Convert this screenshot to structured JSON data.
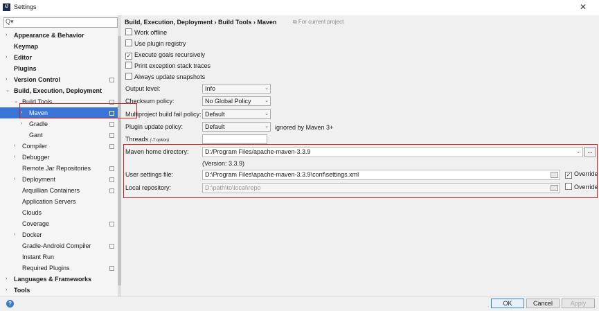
{
  "window": {
    "title": "Settings",
    "app_icon": "IJ"
  },
  "sidebar": {
    "search_placeholder": "Q▾",
    "items": [
      {
        "label": "Appearance & Behavior",
        "level": 0,
        "arrow": "›",
        "bold": true
      },
      {
        "label": "Keymap",
        "level": 0,
        "arrow": "",
        "bold": true
      },
      {
        "label": "Editor",
        "level": 0,
        "arrow": "›",
        "bold": true
      },
      {
        "label": "Plugins",
        "level": 0,
        "arrow": "",
        "bold": true
      },
      {
        "label": "Version Control",
        "level": 0,
        "arrow": "›",
        "bold": true,
        "project": true
      },
      {
        "label": "Build, Execution, Deployment",
        "level": 0,
        "arrow": "⌄",
        "bold": true
      },
      {
        "label": "Build Tools",
        "level": 1,
        "arrow": "⌄",
        "bold": false,
        "project": true
      },
      {
        "label": "Maven",
        "level": 2,
        "arrow": "›",
        "bold": false,
        "project": true,
        "selected": true
      },
      {
        "label": "Gradle",
        "level": 2,
        "arrow": "›",
        "bold": false,
        "project": true
      },
      {
        "label": "Gant",
        "level": 2,
        "arrow": "",
        "bold": false,
        "project": true
      },
      {
        "label": "Compiler",
        "level": 1,
        "arrow": "›",
        "bold": false,
        "project": true
      },
      {
        "label": "Debugger",
        "level": 1,
        "arrow": "›",
        "bold": false
      },
      {
        "label": "Remote Jar Repositories",
        "level": 1,
        "arrow": "",
        "bold": false,
        "project": true
      },
      {
        "label": "Deployment",
        "level": 1,
        "arrow": "›",
        "bold": false,
        "project": true
      },
      {
        "label": "Arquillian Containers",
        "level": 1,
        "arrow": "",
        "bold": false,
        "project": true
      },
      {
        "label": "Application Servers",
        "level": 1,
        "arrow": "",
        "bold": false
      },
      {
        "label": "Clouds",
        "level": 1,
        "arrow": "",
        "bold": false
      },
      {
        "label": "Coverage",
        "level": 1,
        "arrow": "",
        "bold": false,
        "project": true
      },
      {
        "label": "Docker",
        "level": 1,
        "arrow": "›",
        "bold": false
      },
      {
        "label": "Gradle-Android Compiler",
        "level": 1,
        "arrow": "",
        "bold": false,
        "project": true
      },
      {
        "label": "Instant Run",
        "level": 1,
        "arrow": "",
        "bold": false
      },
      {
        "label": "Required Plugins",
        "level": 1,
        "arrow": "",
        "bold": false,
        "project": true
      },
      {
        "label": "Languages & Frameworks",
        "level": 0,
        "arrow": "›",
        "bold": true
      },
      {
        "label": "Tools",
        "level": 0,
        "arrow": "›",
        "bold": true
      }
    ]
  },
  "content": {
    "breadcrumb": "Build, Execution, Deployment  ›  Build Tools  ›  Maven",
    "for_project": "⧉ For current project",
    "checkboxes": [
      {
        "label": "Work offline",
        "checked": false
      },
      {
        "label": "Use plugin registry",
        "checked": false
      },
      {
        "label": "Execute goals recursively",
        "checked": true
      },
      {
        "label": "Print exception stack traces",
        "checked": false
      },
      {
        "label": "Always update snapshots",
        "checked": false
      }
    ],
    "output_level": {
      "label": "Output level:",
      "value": "Info"
    },
    "checksum_policy": {
      "label": "Checksum policy:",
      "value": "No Global Policy"
    },
    "multiproject_fail_policy": {
      "label": "Multiproject build fail policy:",
      "value": "Default"
    },
    "plugin_update_policy": {
      "label": "Plugin update policy:",
      "value": "Default",
      "note": "ignored by Maven 3+"
    },
    "threads": {
      "label": "Threads",
      "hint": "(-T option)",
      "value": ""
    },
    "maven_home": {
      "label": "Maven home directory:",
      "value": "D:/Program Files/apache-maven-3.3.9",
      "version": "(Version: 3.3.9)",
      "browse": "..."
    },
    "user_settings": {
      "label": "User settings file:",
      "value": "D:\\Program Files\\apache-maven-3.3.9\\conf\\settings.xml",
      "override_label": "Override",
      "override_checked": true
    },
    "local_repo": {
      "label": "Local repository:",
      "value": "D:\\path\\to\\local\\repo",
      "override_label": "Override",
      "override_checked": false
    }
  },
  "buttons": {
    "help": "?",
    "ok": "OK",
    "cancel": "Cancel",
    "apply": "Apply"
  },
  "colors": {
    "selection": "#3875d7",
    "highlight_box": "#d02020",
    "help": "#3778d1"
  }
}
